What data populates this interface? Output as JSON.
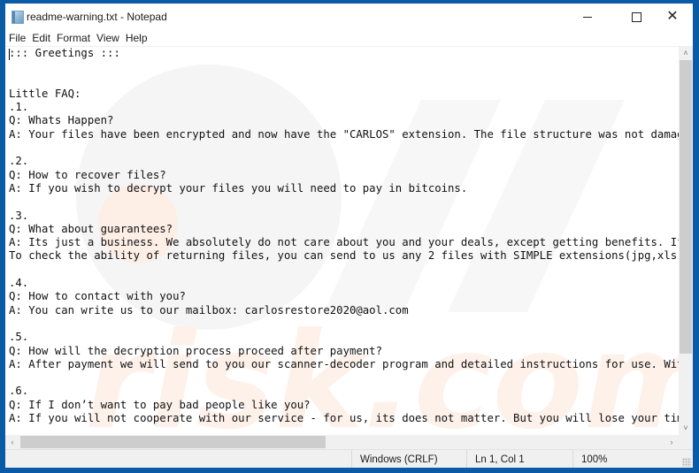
{
  "window": {
    "title": "readme-warning.txt - Notepad",
    "icon": "notepad-icon",
    "controls": {
      "minimize": "minimize-icon",
      "maximize": "maximize-icon",
      "close": "close-icon",
      "close_glyph": "✕"
    }
  },
  "menu": {
    "items": [
      {
        "label": "File"
      },
      {
        "label": "Edit"
      },
      {
        "label": "Format"
      },
      {
        "label": "View"
      },
      {
        "label": "Help"
      }
    ]
  },
  "document": {
    "lines": [
      "::: Greetings :::",
      "",
      "",
      "Little FAQ:",
      ".1.",
      "Q: Whats Happen?",
      "A: Your files have been encrypted and now have the \"CARLOS\" extension. The file structure was not damaged",
      "",
      ".2.",
      "Q: How to recover files?",
      "A: If you wish to decrypt your files you will need to pay in bitcoins.",
      "",
      ".3.",
      "Q: What about guarantees?",
      "A: Its just a business. We absolutely do not care about you and your deals, except getting benefits. If w",
      "To check the ability of returning files, you can send to us any 2 files with SIMPLE extensions(jpg,xls,do",
      "",
      ".4.",
      "Q: How to contact with you?",
      "A: You can write us to our mailbox: carlosrestore2020@aol.com",
      "",
      ".5.",
      "Q: How will the decryption process proceed after payment?",
      "A: After payment we will send to you our scanner-decoder program and detailed instructions for use. With",
      "",
      ".6.",
      "Q: If I don’t want to pay bad people like you?",
      "A: If you will not cooperate with our service - for us, its does not matter. But you will lose your time"
    ]
  },
  "scrollbars": {
    "vertical": {
      "up_glyph": "˄",
      "down_glyph": "˅"
    },
    "horizontal": {
      "left_glyph": "‹",
      "right_glyph": "›"
    }
  },
  "status": {
    "line_ending": "Windows (CRLF)",
    "position": "Ln 1, Col 1",
    "zoom": "100%"
  },
  "colors": {
    "desktop_border": "#0b5aa6",
    "watermark": "#f5f5f5",
    "watermark_accent": "#fdeee6"
  }
}
